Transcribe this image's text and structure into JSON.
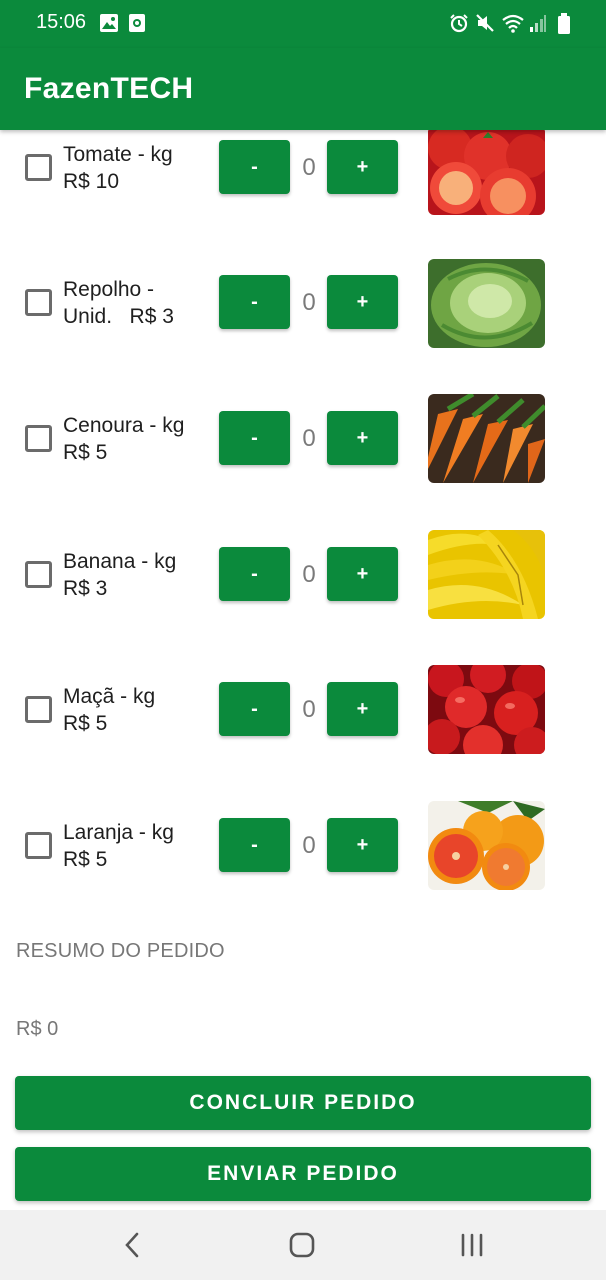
{
  "status_bar": {
    "time": "15:06",
    "left_icons": [
      "image-icon",
      "screen-record-icon"
    ],
    "right_icons": [
      "alarm-icon",
      "mute-icon",
      "wifi-icon",
      "signal-icon",
      "battery-icon"
    ]
  },
  "app_bar": {
    "title": "FazenTECH",
    "color": "#0b8a3c"
  },
  "products": [
    {
      "label": "Tomate - kg\nR$ 10",
      "quantity": "0",
      "minus": "-",
      "plus": "+",
      "image": "tomato-image"
    },
    {
      "label": "Repolho -\nUnid.   R$ 3",
      "quantity": "0",
      "minus": "-",
      "plus": "+",
      "image": "cabbage-image"
    },
    {
      "label": "Cenoura - kg\nR$ 5",
      "quantity": "0",
      "minus": "-",
      "plus": "+",
      "image": "carrot-image"
    },
    {
      "label": "Banana - kg\nR$ 3",
      "quantity": "0",
      "minus": "-",
      "plus": "+",
      "image": "banana-image"
    },
    {
      "label": "Maçã - kg\nR$ 5",
      "quantity": "0",
      "minus": "-",
      "plus": "+",
      "image": "apple-image"
    },
    {
      "label": "Laranja - kg\nR$ 5",
      "quantity": "0",
      "minus": "-",
      "plus": "+",
      "image": "orange-image"
    }
  ],
  "summary": {
    "label": "RESUMO DO PEDIDO",
    "total": "R$ 0"
  },
  "actions": {
    "conclude": "CONCLUIR PEDIDO",
    "send": "ENVIAR PEDIDO"
  },
  "nav_bar": {
    "icons": [
      "back-icon",
      "home-icon",
      "recents-icon"
    ]
  }
}
